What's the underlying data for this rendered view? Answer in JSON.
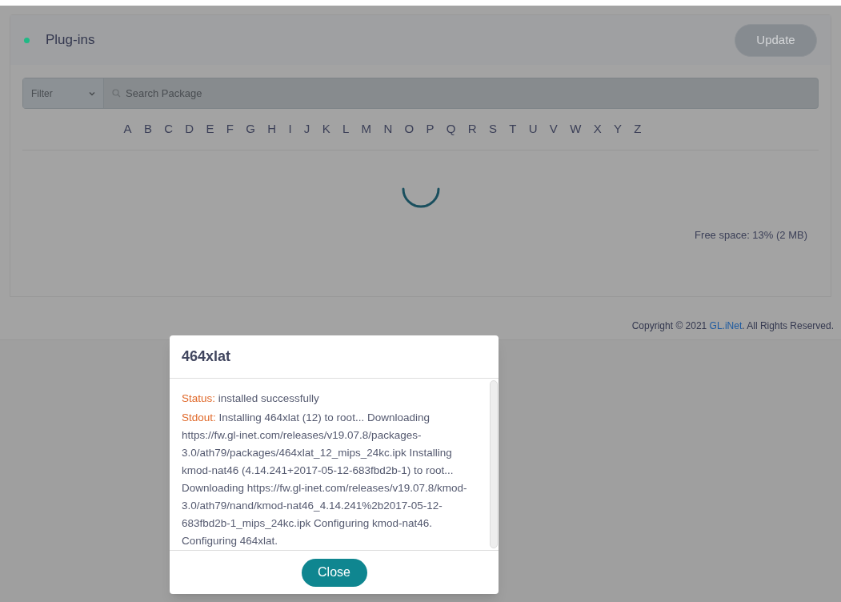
{
  "panel": {
    "title": "Plug-ins",
    "status_dot": {
      "color": "#1fb985"
    },
    "update_button": {
      "label": "Update",
      "disabled": true
    }
  },
  "filter": {
    "label": "Filter"
  },
  "search": {
    "placeholder": "Search Package"
  },
  "letters": [
    "A",
    "B",
    "C",
    "D",
    "E",
    "F",
    "G",
    "H",
    "I",
    "J",
    "K",
    "L",
    "M",
    "N",
    "O",
    "P",
    "Q",
    "R",
    "S",
    "T",
    "U",
    "V",
    "W",
    "X",
    "Y",
    "Z"
  ],
  "loading": true,
  "free_space": "Free space: 13% (2 MB)",
  "footer": {
    "before": "Copyright © 2021",
    "link": "GL.iNet",
    "after": ". All Rights Reserved."
  },
  "dialog": {
    "title": "464xlat",
    "lines": [
      {
        "label": "Status:",
        "text": "installed successfully"
      },
      {
        "label": "Stdout:",
        "text": "Installing 464xlat (12) to root... Downloading https://fw.gl-inet.com/releases/v19.07.8/packages-3.0/ath79/packages/464xlat_12_mips_24kc.ipk Installing kmod-nat46 (4.14.241+2017-05-12-683fbd2b-1) to root... Downloading https://fw.gl-inet.com/releases/v19.07.8/kmod-3.0/ath79/nand/kmod-nat46_4.14.241%2b2017-05-12-683fbd2b-1_mips_24kc.ipk Configuring kmod-nat46. Configuring 464xlat."
      }
    ],
    "close_button": "Close"
  }
}
